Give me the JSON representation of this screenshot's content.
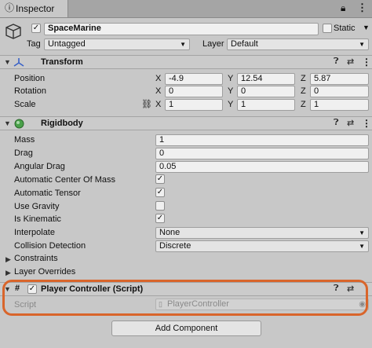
{
  "window": {
    "tab_title": "Inspector"
  },
  "gameobject": {
    "name": "SpaceMarine",
    "active_checked": true,
    "static_label": "Static",
    "tag_label": "Tag",
    "tag_value": "Untagged",
    "layer_label": "Layer",
    "layer_value": "Default"
  },
  "transform": {
    "title": "Transform",
    "rows": [
      {
        "label": "Position",
        "x": "-4.9",
        "y": "12.54",
        "z": "5.87"
      },
      {
        "label": "Rotation",
        "x": "0",
        "y": "0",
        "z": "0"
      },
      {
        "label": "Scale",
        "x": "1",
        "y": "1",
        "z": "1"
      }
    ],
    "axes": {
      "x": "X",
      "y": "Y",
      "z": "Z"
    }
  },
  "rigidbody": {
    "title": "Rigidbody",
    "mass_label": "Mass",
    "mass": "1",
    "drag_label": "Drag",
    "drag": "0",
    "angular_drag_label": "Angular Drag",
    "angular_drag": "0.05",
    "auto_com_label": "Automatic Center Of Mass",
    "auto_com": true,
    "auto_tensor_label": "Automatic Tensor",
    "auto_tensor": true,
    "use_gravity_label": "Use Gravity",
    "use_gravity": false,
    "is_kinematic_label": "Is Kinematic",
    "is_kinematic": true,
    "interpolate_label": "Interpolate",
    "interpolate": "None",
    "collision_label": "Collision Detection",
    "collision": "Discrete",
    "constraints_label": "Constraints",
    "layer_overrides_label": "Layer Overrides"
  },
  "script_component": {
    "title": "Player Controller (Script)",
    "enabled": true,
    "script_label": "Script",
    "script_value": "PlayerController"
  },
  "add_component_label": "Add Component",
  "colors": {
    "highlight": "#d9652b",
    "panel_bg": "#c8c8c8",
    "field_bg": "#f0f0f0"
  }
}
